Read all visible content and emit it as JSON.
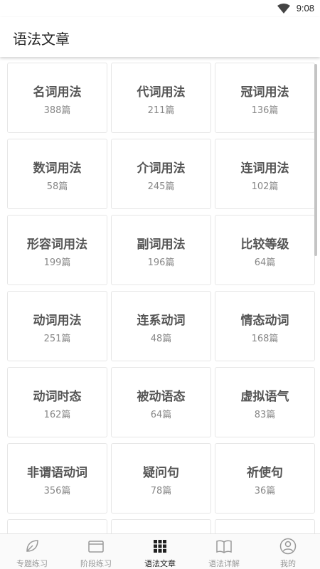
{
  "status_bar": {
    "time": "9:08"
  },
  "app_bar": {
    "title": "语法文章"
  },
  "categories": [
    {
      "name": "名词用法",
      "count": "388篇"
    },
    {
      "name": "代词用法",
      "count": "211篇"
    },
    {
      "name": "冠词用法",
      "count": "136篇"
    },
    {
      "name": "数词用法",
      "count": "58篇"
    },
    {
      "name": "介词用法",
      "count": "245篇"
    },
    {
      "name": "连词用法",
      "count": "102篇"
    },
    {
      "name": "形容词用法",
      "count": "199篇"
    },
    {
      "name": "副词用法",
      "count": "196篇"
    },
    {
      "name": "比较等级",
      "count": "64篇"
    },
    {
      "name": "动词用法",
      "count": "251篇"
    },
    {
      "name": "连系动词",
      "count": "48篇"
    },
    {
      "name": "情态动词",
      "count": "168篇"
    },
    {
      "name": "动词时态",
      "count": "162篇"
    },
    {
      "name": "被动语态",
      "count": "64篇"
    },
    {
      "name": "虚拟语气",
      "count": "83篇"
    },
    {
      "name": "非谓语动词",
      "count": "356篇"
    },
    {
      "name": "疑问句",
      "count": "78篇"
    },
    {
      "name": "祈使句",
      "count": "36篇"
    },
    {
      "name": "",
      "count": ""
    },
    {
      "name": "",
      "count": ""
    },
    {
      "name": "",
      "count": ""
    }
  ],
  "bottom_nav": {
    "items": [
      {
        "label": "专题练习",
        "icon": "leaf-icon"
      },
      {
        "label": "阶段练习",
        "icon": "folder-icon"
      },
      {
        "label": "语法文章",
        "icon": "grid-icon"
      },
      {
        "label": "语法详解",
        "icon": "book-icon"
      },
      {
        "label": "我的",
        "icon": "user-icon"
      }
    ],
    "active_index": 2
  },
  "colors": {
    "active": "#222222",
    "inactive": "#999999",
    "tile_border": "#e6e6e6"
  }
}
